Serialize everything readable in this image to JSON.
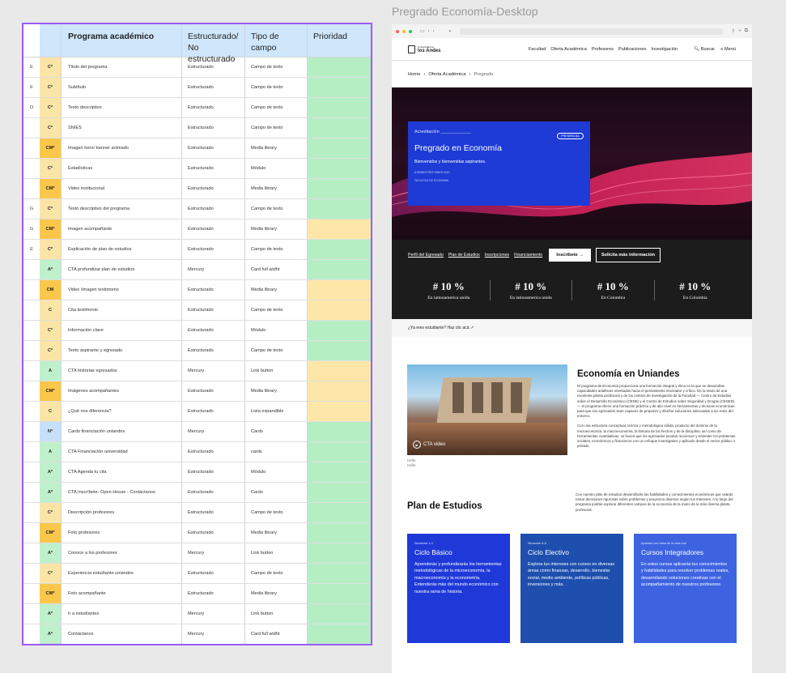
{
  "frame_title": "Pregrado Economía-Desktop",
  "table": {
    "headers": {
      "programa": "Programa académico",
      "estructurado": "Estructurado/ No estructurado",
      "tipo": "Tipo de campo",
      "prioridad": "Prioridad"
    },
    "rows": [
      {
        "e": "E",
        "tag": "C*",
        "tag_color": "y",
        "name": "Título del programa",
        "struct": "Estructurado",
        "field": "Campo de texto",
        "pri": "g"
      },
      {
        "e": "E",
        "tag": "C*",
        "tag_color": "y",
        "name": "Subtítulo",
        "struct": "Estructurado",
        "field": "Campo de texto",
        "pri": "g"
      },
      {
        "e": "O",
        "tag": "C*",
        "tag_color": "y",
        "name": "Texto descriptivo",
        "struct": "Estructurado",
        "field": "Campo de texto",
        "pri": "g"
      },
      {
        "e": "",
        "tag": "C*",
        "tag_color": "y",
        "name": "SNIES",
        "struct": "Estructurado",
        "field": "Campo de texto",
        "pri": "g"
      },
      {
        "e": "",
        "tag": "CM*",
        "tag_color": "o",
        "name": "Imagen hero/ banner animado",
        "struct": "Estructurado",
        "field": "Media library",
        "pri": "g"
      },
      {
        "e": "",
        "tag": "C*",
        "tag_color": "y",
        "name": "Estadísticas",
        "struct": "Estructurado",
        "field": "Módulo",
        "pri": "g"
      },
      {
        "e": "",
        "tag": "CM*",
        "tag_color": "o",
        "name": "Video institucional",
        "struct": "Estructurado",
        "field": "Media library",
        "pri": "g"
      },
      {
        "e": "G",
        "tag": "C*",
        "tag_color": "y",
        "name": "Texto descriptivo del programa",
        "struct": "Estructurado",
        "field": "Campo de texto",
        "pri": "g"
      },
      {
        "e": "G",
        "tag": "CM*",
        "tag_color": "o",
        "name": "Imagen acompañante",
        "struct": "Estructurado",
        "field": "Media library",
        "pri": "y"
      },
      {
        "e": "E",
        "tag": "C*",
        "tag_color": "y",
        "name": "Explicación de plan de estudios",
        "struct": "Estructurado",
        "field": "Campo de texto",
        "pri": "g"
      },
      {
        "e": "",
        "tag": "A*",
        "tag_color": "g",
        "name": "CTA profundizar plan de estudios",
        "struct": "Mercury",
        "field": "Card full widht",
        "pri": "g"
      },
      {
        "e": "",
        "tag": "CM",
        "tag_color": "o",
        "name": "Video /imagen testimonio",
        "struct": "Estructurado",
        "field": "Media library",
        "pri": "y"
      },
      {
        "e": "",
        "tag": "C",
        "tag_color": "y",
        "name": "Cita testimonio",
        "struct": "Estructurado",
        "field": "Campo de texto",
        "pri": "y"
      },
      {
        "e": "",
        "tag": "C*",
        "tag_color": "y",
        "name": "Información clave",
        "struct": "Estructurado",
        "field": "Módulo",
        "pri": "g"
      },
      {
        "e": "",
        "tag": "C*",
        "tag_color": "y",
        "name": "Texto aspirante y egresado",
        "struct": "Estructurado",
        "field": "Campo de texto",
        "pri": "g"
      },
      {
        "e": "",
        "tag": "A",
        "tag_color": "g",
        "name": "CTA historias egresados",
        "struct": "Mercury",
        "field": "Link button",
        "pri": "y"
      },
      {
        "e": "",
        "tag": "CM*",
        "tag_color": "o",
        "name": "Imágenes acompañantes",
        "struct": "Estructurado",
        "field": "Media library",
        "pri": "y"
      },
      {
        "e": "",
        "tag": "C",
        "tag_color": "y",
        "name": "¿Qué nos diferencia?",
        "struct": "Estructurado",
        "field": "Lista expandible",
        "pri": "y"
      },
      {
        "e": "",
        "tag": "N*",
        "tag_color": "b",
        "name": "Cards financiación uniandes",
        "struct": "Mercury",
        "field": "Cards",
        "pri": "g"
      },
      {
        "e": "",
        "tag": "A",
        "tag_color": "g",
        "name": "CTA Financiación universidad",
        "struct": "Estructurado",
        "field": "cards",
        "pri": "g"
      },
      {
        "e": "",
        "tag": "A*",
        "tag_color": "g",
        "name": "CTA Agenda tu cita",
        "struct": "Estructurado",
        "field": "Módulo",
        "pri": "g"
      },
      {
        "e": "",
        "tag": "A*",
        "tag_color": "g",
        "name": "CTA Inscríbete- Open House - Contáctanos",
        "struct": "Estructurado",
        "field": "Cards",
        "pri": "g"
      },
      {
        "e": "",
        "tag": "C*",
        "tag_color": "y",
        "name": "Descripción profesores",
        "struct": "Estructurado",
        "field": "Campo de texto",
        "pri": "g"
      },
      {
        "e": "",
        "tag": "CM*",
        "tag_color": "o",
        "name": "Foto profesores",
        "struct": "Estructurado",
        "field": "Media library",
        "pri": "g"
      },
      {
        "e": "",
        "tag": "A*",
        "tag_color": "g",
        "name": "Conoce a los profesores",
        "struct": "Mercury",
        "field": "Link button",
        "pri": "g"
      },
      {
        "e": "",
        "tag": "C*",
        "tag_color": "y",
        "name": "Experiencia estudiante uniandes",
        "struct": "Estructurado",
        "field": "Campo de texto",
        "pri": "g"
      },
      {
        "e": "",
        "tag": "CM*",
        "tag_color": "o",
        "name": "Foto acompañante",
        "struct": "Estructurado",
        "field": "Media library",
        "pri": "g"
      },
      {
        "e": "",
        "tag": "A*",
        "tag_color": "g",
        "name": "Ir a estudiantes",
        "struct": "Mercury",
        "field": "Link button",
        "pri": "g"
      },
      {
        "e": "",
        "tag": "A*",
        "tag_color": "g",
        "name": "Contáctanos",
        "struct": "Mercury",
        "field": "Card full widht",
        "pri": "g"
      }
    ]
  },
  "page": {
    "logo_text": "los Andes",
    "logo_small": "Universidad de",
    "nav": [
      "Facultad",
      "Oferta Académica",
      "Profesores",
      "Publicaciones",
      "Investigación"
    ],
    "search": "Buscar",
    "menu": "Menú",
    "breadcrumb": {
      "home": "Home",
      "section": "Oferta Académica",
      "current": "Pregrado"
    },
    "hero": {
      "acreditacion": "Acreditación ____________",
      "pill": "PRESENCIAL",
      "title": "Pregrado en Economía",
      "subtitle": "Bienvenidos y bienvenidas aspirantes.",
      "meta": "8 SEMESTRES     SNIES 1520",
      "meta2": "FACULTAD DE ECONOMÍA"
    },
    "links": [
      "Perfil del Egresado",
      "Plan de Estudios",
      "Inscripciones",
      "Financiamiento"
    ],
    "btn_primary": "Inscríbete  →",
    "btn_secondary": "Solicita más información",
    "stats": [
      {
        "num": "# 10 %",
        "lbl": "En latinoamerica unida"
      },
      {
        "num": "# 10 %",
        "lbl": "En latinoamerica unida"
      },
      {
        "num": "# 10 %",
        "lbl": "En Colombia"
      },
      {
        "num": "# 10 %",
        "lbl": "En Colombia"
      }
    ],
    "student_link": "¿Ya eres estudiante? Haz clic acá ↗",
    "video_label": "CTA video",
    "caption": "Hello\nHello",
    "about_title": "Economía en Uniandes",
    "about_p1": "El programa de Economía proporciona una formación integral y ética en la que se desarrollan capacidades analíticas orientadas hacia el pensamiento innovador y crítico. De la mano de una excelente planta profesoral y de los centros de investigación de la Facultad — Centro de Estudios sobre el Desarrollo Económico (CEDE) y el Centro de Estudios sobre Seguridad y Drogas (CESED) — el programa ofrece una formación práctica y de alto nivel en herramientas y técnicas económicas para que sus egresados sean capaces de proponer y diseñar soluciones adecuadas a los retos del entorno.",
    "about_p2": "Con una estructura conceptual, teórica y metodológica sólida, producto del dominio de la microeconomía, la macroeconomía, la historia de los hechos y de la disciplina, así como de herramientas cuantitativas, se busca que los egresados puedan reconocer y entender los problemas sociales, económicos y financieros con un enfoque investigativo y aplicado desde el sector público o privado.",
    "plan_title": "Plan de Estudios",
    "plan_text": "Con nuestro plan de estudios desarrollarás las habilidades y conocimientos económicos que usarás tomar decisiones rigurosas sobre problemas y proyectos diversos según tus intereses. A lo largo del programa podrás explorar diferentes campos de la economía de la mano de la más diversa planta profesoral.",
    "cards": [
      {
        "small": "Semestre 1-4",
        "title": "Ciclo Básico",
        "body": "Aprenderás y profundizarás los herramientas metodológicas de la microeconomía, la macroeconomía y la econometría. Entenderás más del mundo económico con nuestra rama de historia.",
        "color": "#1f39d9"
      },
      {
        "small": "Semestre 6-8",
        "title": "Ciclo Electivo",
        "body": "Explora tus intereses con cursos en diversas áreas como finanzas, desarrollo, bienestar social, medio ambiente, políticas públicas, inversiones y más.",
        "color": "#1e4fae"
      },
      {
        "small": "Aprende con retos de la vida real",
        "title": "Cursos Integradores",
        "body": "En estos cursos aplicarás tus conocimientos y habilidades para resolver problemas reales, desarrollando soluciones creativas con el acompañamiento de nuestros profesores.",
        "color": "#3e63e0"
      }
    ]
  }
}
